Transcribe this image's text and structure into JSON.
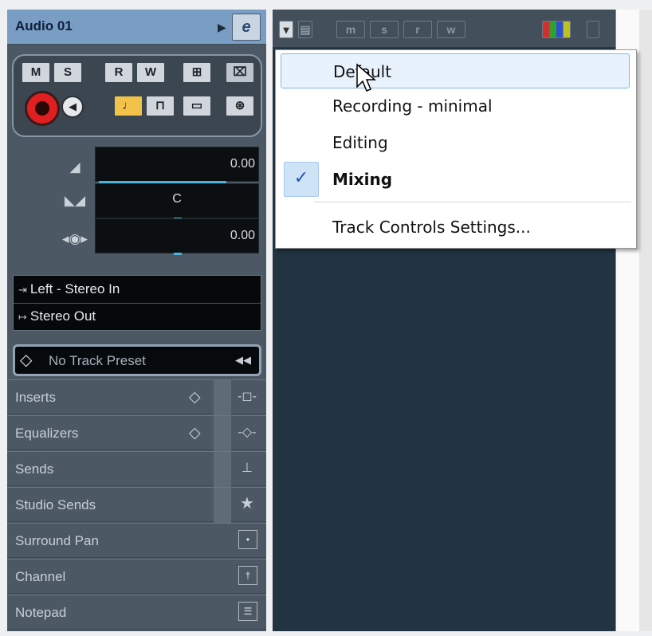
{
  "inspector": {
    "track_title": "Audio 01",
    "edit_button": "e",
    "buttons": {
      "mute": "M",
      "solo": "S",
      "read": "R",
      "write": "W"
    },
    "volume": "0.00",
    "pan": "C",
    "delay": "0.00",
    "input_routing": "Left - Stereo In",
    "output_routing": "Stereo Out",
    "preset": "No Track Preset",
    "sections": [
      {
        "label": "Inserts"
      },
      {
        "label": "Equalizers"
      },
      {
        "label": "Sends"
      },
      {
        "label": "Studio Sends"
      },
      {
        "label": "Surround Pan"
      },
      {
        "label": "Channel"
      },
      {
        "label": "Notepad"
      }
    ]
  },
  "toolbar": {
    "items": [
      "m",
      "s",
      "r",
      "w"
    ]
  },
  "menu": {
    "items": [
      {
        "label": "Default",
        "highlighted": true,
        "checked": false
      },
      {
        "label": "Recording - minimal",
        "highlighted": false,
        "checked": false
      },
      {
        "label": "Editing",
        "highlighted": false,
        "checked": false
      },
      {
        "label": "Mixing",
        "highlighted": false,
        "checked": true
      }
    ],
    "settings_label": "Track Controls Settings...",
    "checkmark": "✓"
  },
  "colors": {
    "header": "#7a9dc4",
    "record": "#e02020",
    "accent_yellow": "#f2c24a",
    "meter": "#4ab4d8",
    "menu_highlight": "#e8f2fc"
  }
}
